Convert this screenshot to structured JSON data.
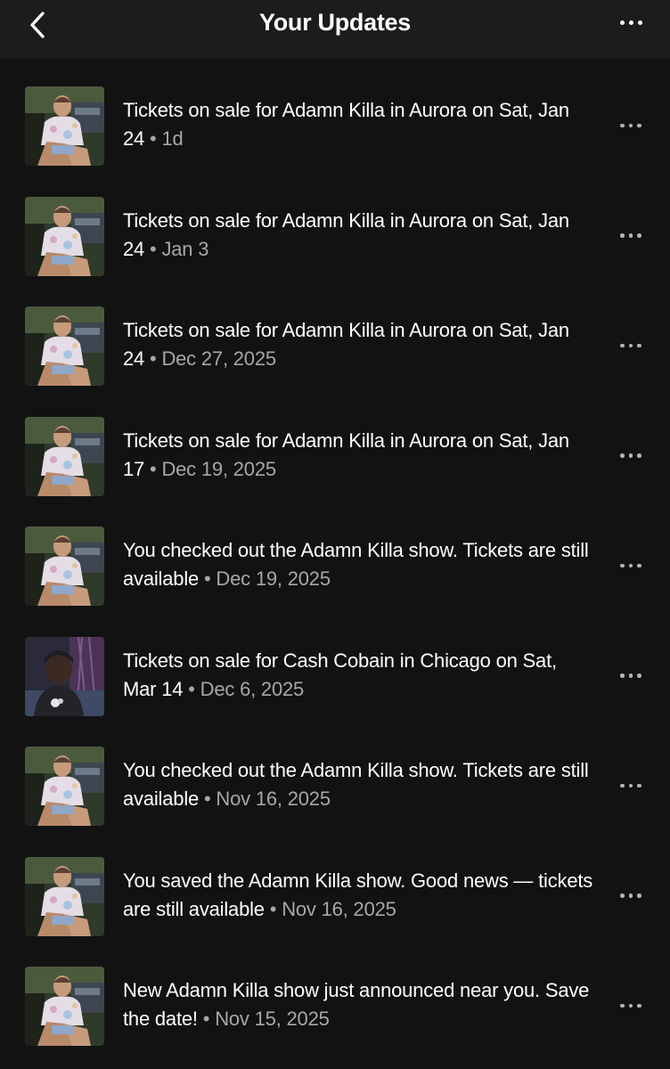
{
  "header": {
    "title": "Your Updates",
    "back_icon": "chevron-left-icon",
    "more_icon": "more-horizontal-icon"
  },
  "updates": [
    {
      "text": "Tickets on sale for Adamn Killa in Aurora on Sat, Jan 24",
      "date": "1d",
      "artist_image": "adamn-killa"
    },
    {
      "text": "Tickets on sale for Adamn Killa in Aurora on Sat, Jan 24",
      "date": "Jan 3",
      "artist_image": "adamn-killa"
    },
    {
      "text": "Tickets on sale for Adamn Killa in Aurora on Sat, Jan 24",
      "date": "Dec 27, 2025",
      "artist_image": "adamn-killa"
    },
    {
      "text": "Tickets on sale for Adamn Killa in Aurora on Sat, Jan 17",
      "date": "Dec 19, 2025",
      "artist_image": "adamn-killa"
    },
    {
      "text": "You checked out the Adamn Killa show. Tickets are still available",
      "date": "Dec 19, 2025",
      "artist_image": "adamn-killa"
    },
    {
      "text": "Tickets on sale for Cash Cobain in Chicago on Sat, Mar 14",
      "date": "Dec 6, 2025",
      "artist_image": "cash-cobain"
    },
    {
      "text": "You checked out the Adamn Killa show. Tickets are still available",
      "date": "Nov 16, 2025",
      "artist_image": "adamn-killa"
    },
    {
      "text": "You saved the Adamn Killa show. Good news — tickets are still available",
      "date": "Nov 16, 2025",
      "artist_image": "adamn-killa"
    },
    {
      "text": "New Adamn Killa show just announced near you. Save the date!",
      "date": "Nov 15, 2025",
      "artist_image": "adamn-killa"
    }
  ],
  "separator": "•",
  "colors": {
    "background": "#121212",
    "header_background": "#1c1c1c",
    "text_primary": "#ffffff",
    "text_secondary": "#a7a7a7"
  }
}
